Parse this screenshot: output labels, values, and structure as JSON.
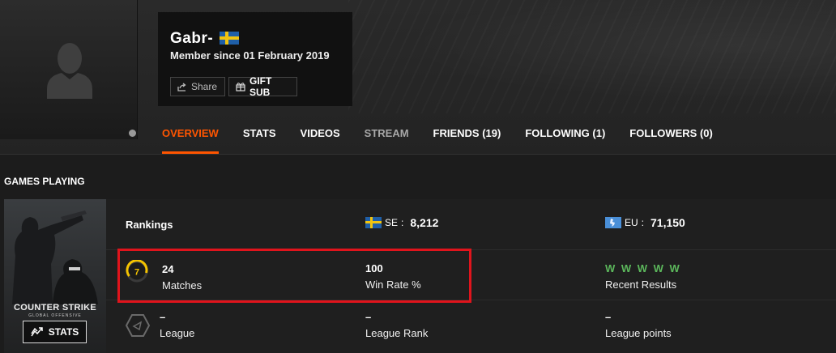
{
  "profile": {
    "nickname": "Gabr-",
    "country_flag": "sweden-flag",
    "member_since": "Member since 01 February 2019",
    "share_label": "Share",
    "gift_label": "GIFT SUB",
    "status_color": "#9a9a9a"
  },
  "nav": {
    "tabs": [
      {
        "label": "OVERVIEW",
        "active": true
      },
      {
        "label": "STATS"
      },
      {
        "label": "VIDEOS"
      },
      {
        "label": "STREAM"
      },
      {
        "label": "FRIENDS (19)"
      },
      {
        "label": "FOLLOWING (1)"
      },
      {
        "label": "FOLLOWERS (0)"
      }
    ]
  },
  "games": {
    "section_title": "GAMES PLAYING",
    "cover": {
      "title": "COUNTER STRIKE",
      "subtitle": "GLOBAL OFFENSIVE",
      "stats_label": "STATS"
    },
    "rankings": {
      "label": "Rankings",
      "se": {
        "label": "SE",
        "separator": ":",
        "value": "8,212"
      },
      "eu": {
        "label": "EU",
        "separator": ":",
        "value": "71,150"
      }
    },
    "stats": {
      "level": "7",
      "matches_value": "24",
      "matches_label": "Matches",
      "winrate_value": "100",
      "winrate_label": "Win Rate %",
      "recent_results": "W W W W W",
      "recent_label": "Recent Results"
    },
    "league": {
      "league_value": "–",
      "league_label": "League",
      "rank_value": "–",
      "rank_label": "League Rank",
      "points_value": "–",
      "points_label": "League points"
    }
  },
  "colors": {
    "accent": "#ff5500",
    "win": "#5cb85c",
    "highlight": "#e0141c",
    "level": "#f5c400"
  }
}
